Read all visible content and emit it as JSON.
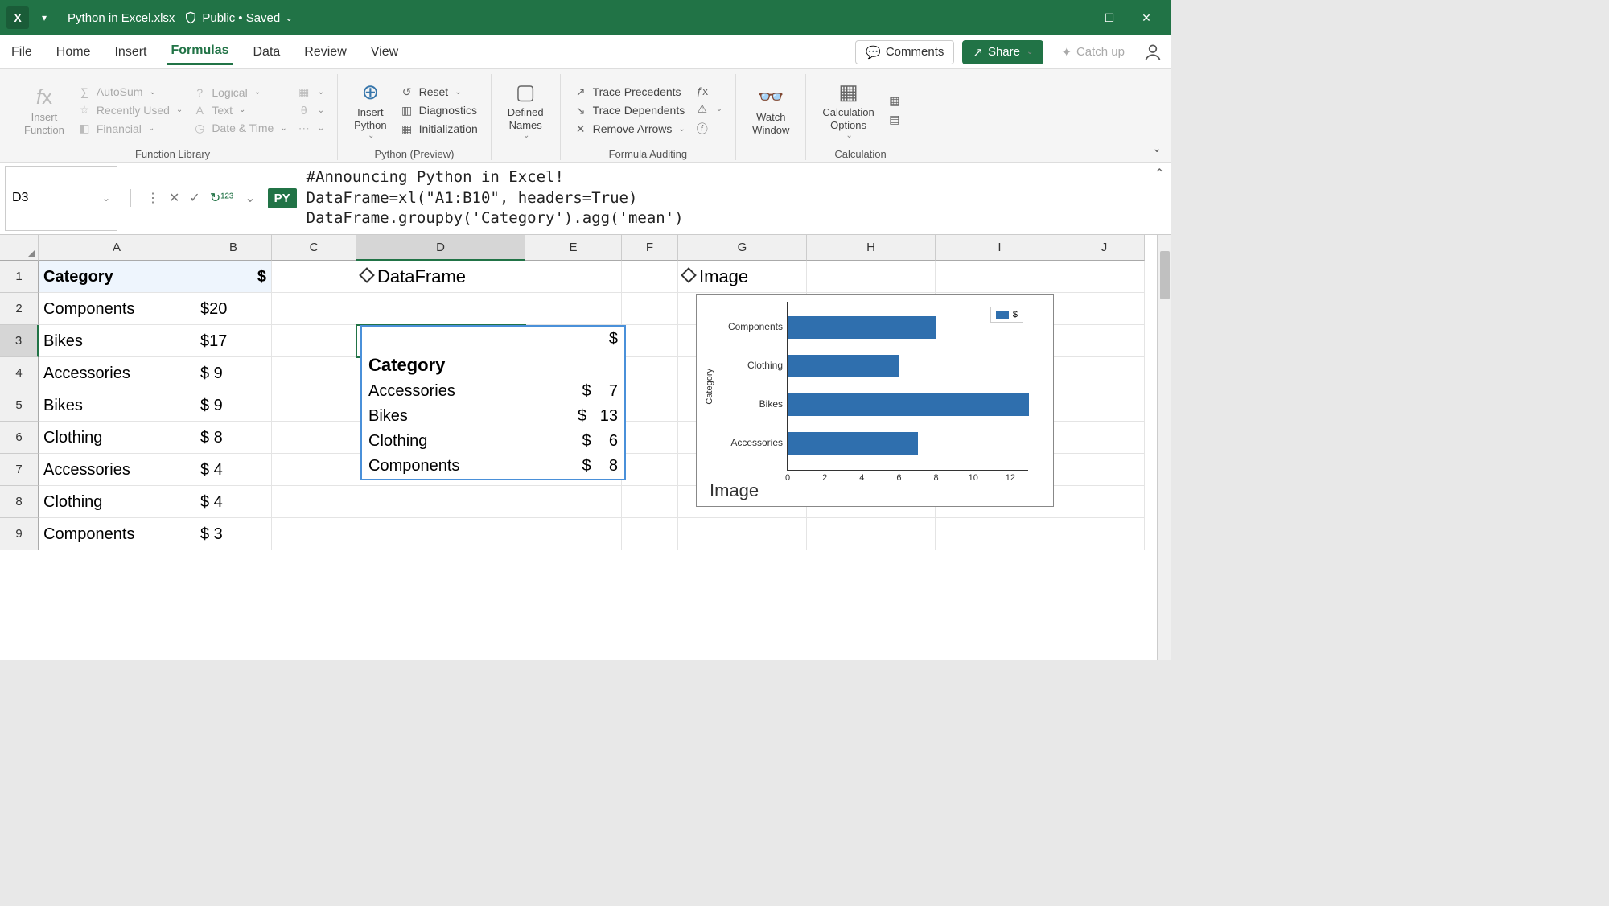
{
  "titlebar": {
    "filename": "Python in Excel.xlsx",
    "classification": "Public",
    "save_state": "• Saved"
  },
  "tabs": {
    "file": "File",
    "home": "Home",
    "insert": "Insert",
    "formulas": "Formulas",
    "data": "Data",
    "review": "Review",
    "view": "View",
    "comments": "Comments",
    "share": "Share",
    "catchup": "Catch up"
  },
  "ribbon": {
    "insert_function": "Insert\nFunction",
    "autosum": "AutoSum",
    "recently_used": "Recently Used",
    "financial": "Financial",
    "logical": "Logical",
    "text": "Text",
    "datetime": "Date & Time",
    "group_funclib": "Function Library",
    "insert_python": "Insert\nPython",
    "reset": "Reset",
    "diagnostics": "Diagnostics",
    "initialization": "Initialization",
    "group_python": "Python (Preview)",
    "defined_names": "Defined\nNames",
    "trace_precedents": "Trace Precedents",
    "trace_dependents": "Trace Dependents",
    "remove_arrows": "Remove Arrows",
    "group_audit": "Formula Auditing",
    "watch_window": "Watch\nWindow",
    "calc_options": "Calculation\nOptions",
    "group_calc": "Calculation"
  },
  "formula_bar": {
    "cell_ref": "D3",
    "py_badge": "PY",
    "code": "#Announcing Python in Excel!\nDataFrame=xl(\"A1:B10\", headers=True)\nDataFrame.groupby('Category').agg('mean')"
  },
  "columns": [
    "A",
    "B",
    "C",
    "D",
    "E",
    "F",
    "G",
    "H",
    "I",
    "J"
  ],
  "sheet": {
    "hdr_category": "Category",
    "hdr_dollar": "$",
    "rows": [
      {
        "cat": "Components",
        "val": "$20"
      },
      {
        "cat": "Bikes",
        "val": "$17"
      },
      {
        "cat": "Accessories",
        "val": "$  9"
      },
      {
        "cat": "Bikes",
        "val": "$  9"
      },
      {
        "cat": "Clothing",
        "val": "$  8"
      },
      {
        "cat": "Accessories",
        "val": "$  4"
      },
      {
        "cat": "Clothing",
        "val": "$  4"
      },
      {
        "cat": "Components",
        "val": "$  3"
      }
    ],
    "d1_label": "DataFrame",
    "g1_label": "Image"
  },
  "df_card": {
    "dollar": "$",
    "category": "Category",
    "rows": [
      {
        "cat": "Accessories",
        "sym": "$",
        "val": "7"
      },
      {
        "cat": "Bikes",
        "sym": "$",
        "val": "13"
      },
      {
        "cat": "Clothing",
        "sym": "$",
        "val": "6"
      },
      {
        "cat": "Components",
        "sym": "$",
        "val": "8"
      }
    ]
  },
  "chart_data": {
    "type": "bar",
    "orientation": "horizontal",
    "ylabel": "Category",
    "xlabel": "",
    "legend": "$",
    "categories": [
      "Components",
      "Clothing",
      "Bikes",
      "Accessories"
    ],
    "values": [
      8,
      6,
      13,
      7
    ],
    "xlim": [
      0,
      13
    ],
    "xticks": [
      0,
      2,
      4,
      6,
      8,
      10,
      12
    ],
    "caption": "Image"
  }
}
